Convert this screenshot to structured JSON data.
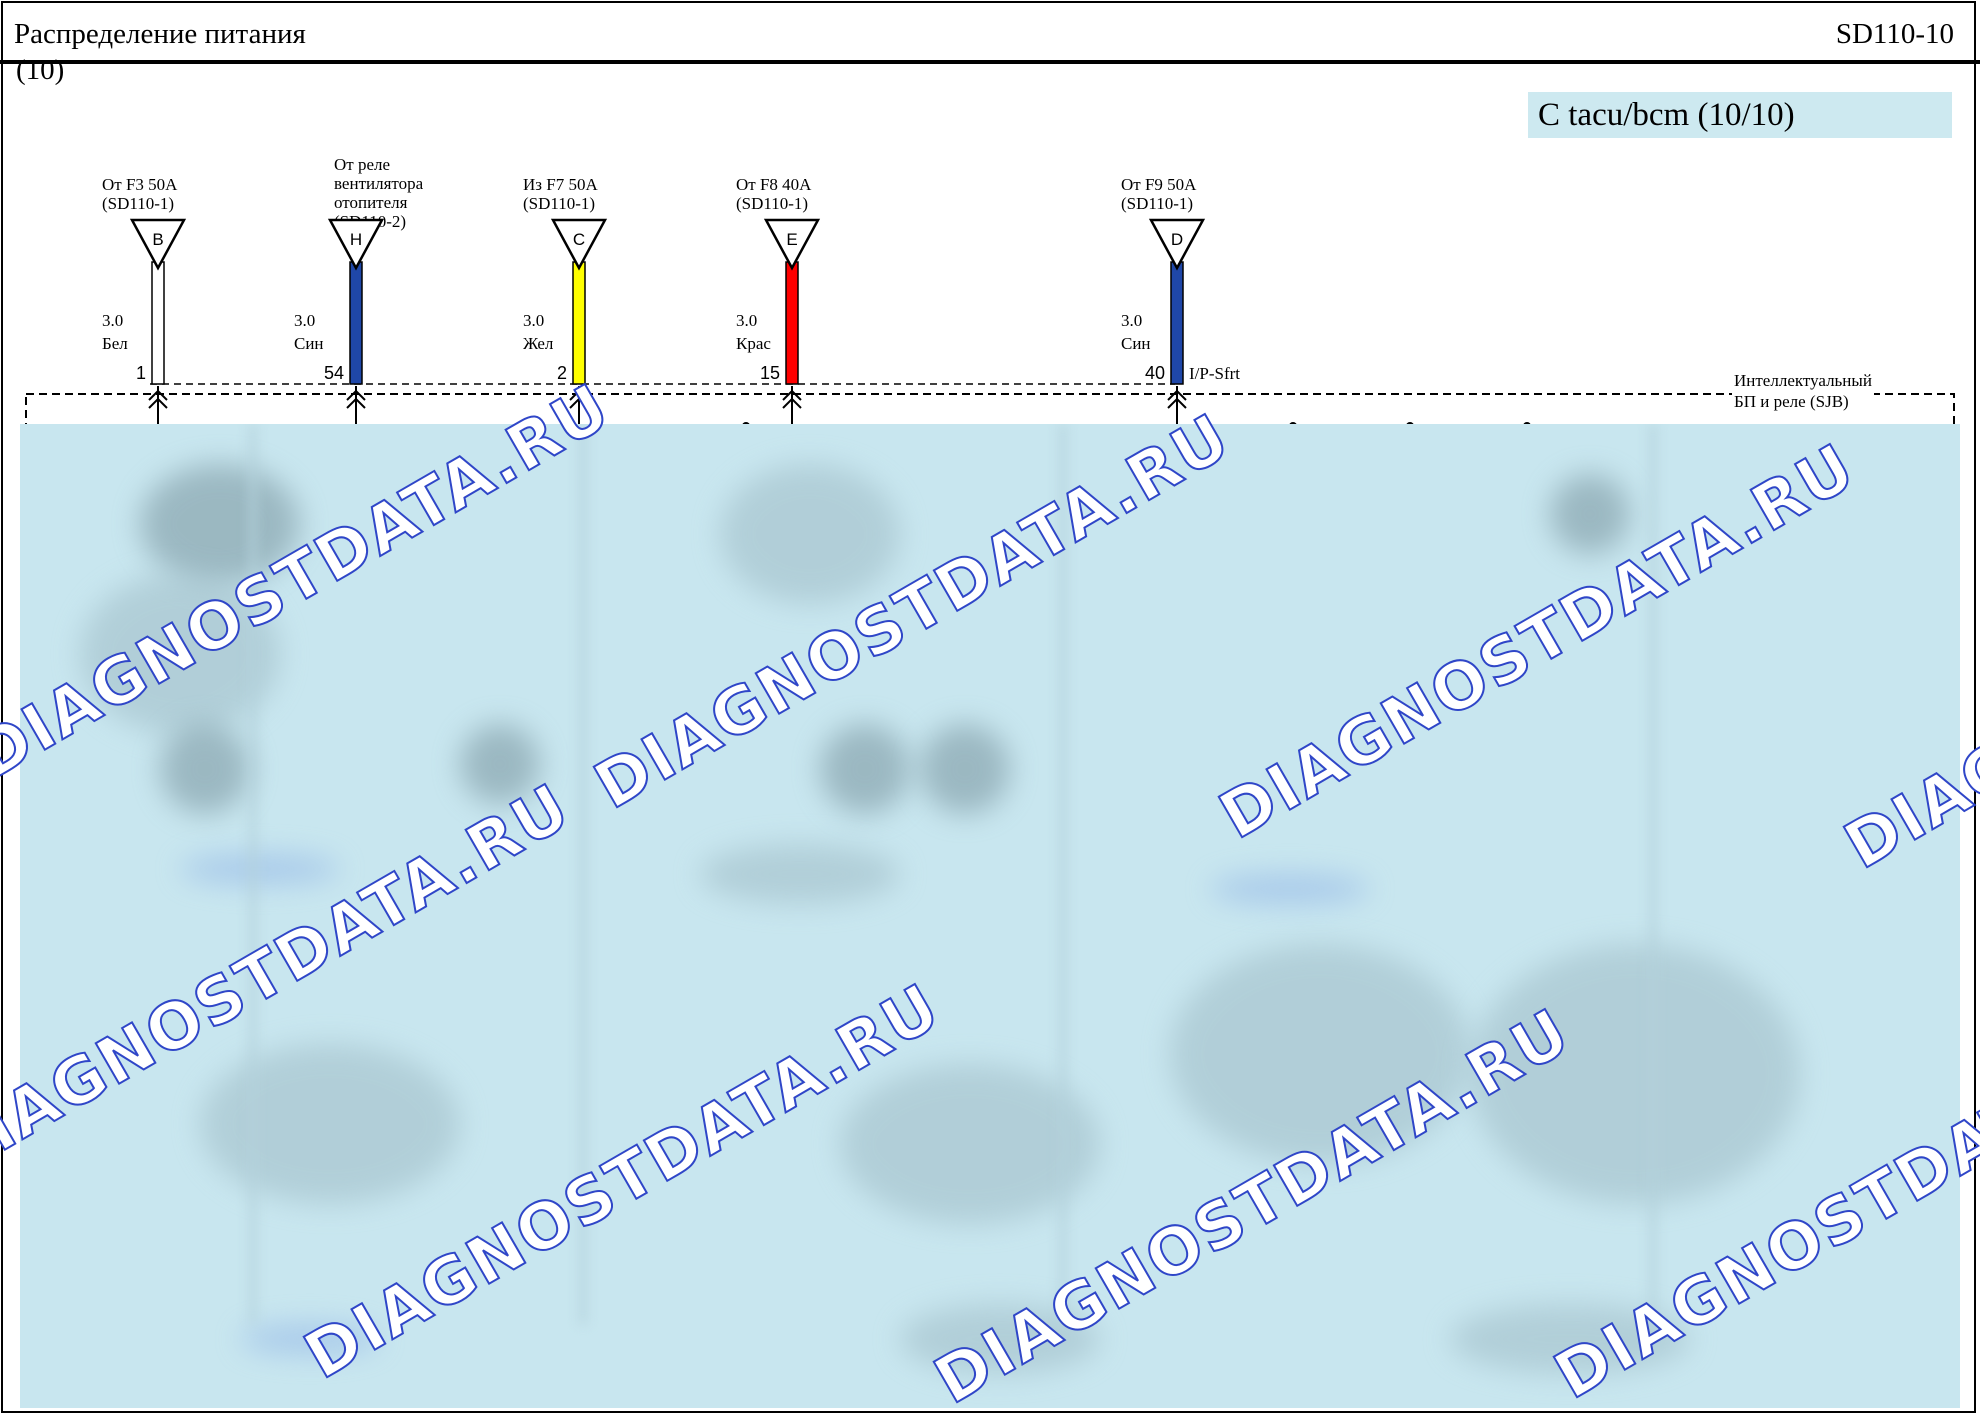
{
  "header": {
    "title": "Распределение питания",
    "title_cont": "(10)",
    "page_code": "SD110-10"
  },
  "variant": {
    "label": "С tacu/bcm (10/10)"
  },
  "module": {
    "label_line1": "Интеллектуальный",
    "label_line2": "БП и реле (SJB)"
  },
  "connectors": [
    {
      "source_lines": [
        "От F3 50A",
        "(SD110-1)"
      ],
      "letter": "B",
      "gauge": "3.0",
      "color_name": "Бел",
      "pin": "1",
      "wire_color": "#ffffff",
      "circuit_label": ""
    },
    {
      "source_lines": [
        "От реле",
        "вентилятора",
        "отопителя",
        "(SD110-2)"
      ],
      "letter": "H",
      "gauge": "3.0",
      "color_name": "Син",
      "pin": "54",
      "wire_color": "#1f47a8",
      "circuit_label": ""
    },
    {
      "source_lines": [
        "Из F7 50A",
        "(SD110-1)"
      ],
      "letter": "C",
      "gauge": "3.0",
      "color_name": "Жел",
      "pin": "2",
      "wire_color": "#ffff00",
      "circuit_label": ""
    },
    {
      "source_lines": [
        "От F8 40A",
        "(SD110-1)"
      ],
      "letter": "E",
      "gauge": "3.0",
      "color_name": "Крас",
      "pin": "15",
      "wire_color": "#ff0000",
      "circuit_label": ""
    },
    {
      "source_lines": [
        "От F9 50A",
        "(SD110-1)"
      ],
      "letter": "D",
      "gauge": "3.0",
      "color_name": "Син",
      "pin": "40",
      "wire_color": "#1f47a8",
      "circuit_label": "I/P-Sfrt"
    }
  ],
  "watermark": {
    "text": "DIAGNOSTDATA.RU"
  },
  "colors": {
    "highlight_box": "#cde9f0",
    "blurred_area": "#c8e6ef",
    "watermark_outline": "#2f46c8"
  }
}
